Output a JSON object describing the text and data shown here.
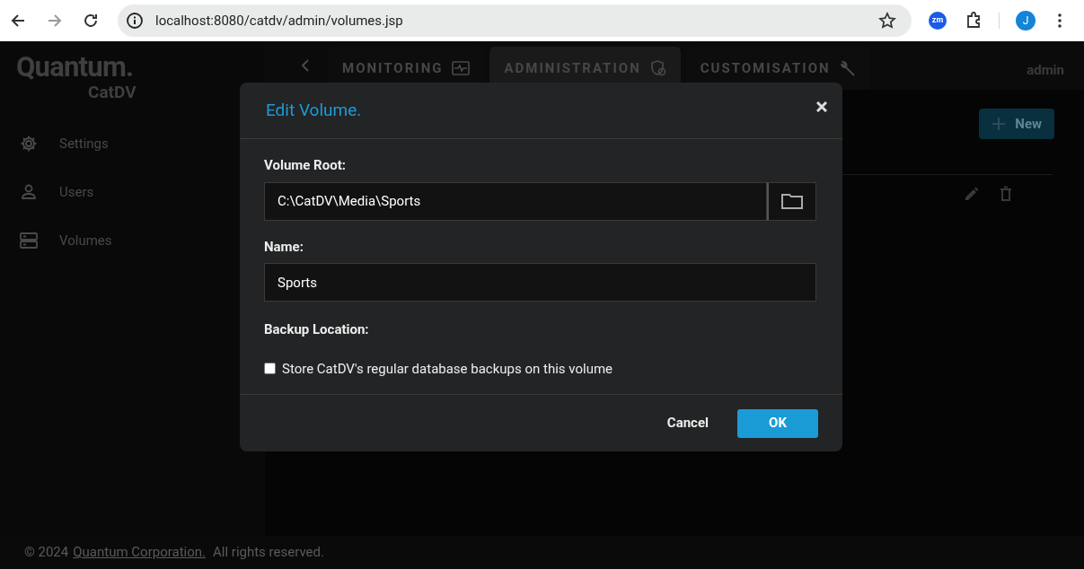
{
  "browser": {
    "url": "localhost:8080/catdv/admin/volumes.jsp",
    "profile_initial": "J",
    "extension_label": "zm"
  },
  "logo": {
    "brand": "Quantum.",
    "product": "CatDV"
  },
  "nav_tabs": [
    {
      "label": "MONITORING",
      "selected": false
    },
    {
      "label": "ADMINISTRATION",
      "selected": true
    },
    {
      "label": "CUSTOMISATION",
      "selected": false
    }
  ],
  "user": "admin",
  "sidebar": {
    "items": [
      {
        "label": "Settings"
      },
      {
        "label": "Users"
      },
      {
        "label": "Volumes"
      }
    ]
  },
  "new_button": {
    "label": "New"
  },
  "dialog": {
    "title": "Edit Volume.",
    "volume_root": {
      "label": "Volume Root:",
      "value": "C:\\CatDV\\Media\\Sports"
    },
    "name": {
      "label": "Name:",
      "value": "Sports"
    },
    "backup": {
      "label": "Backup Location:",
      "checkbox_label": "Store CatDV's regular database backups on this volume",
      "checked": false
    },
    "buttons": [
      {
        "label": "Cancel",
        "kind": "secondary"
      },
      {
        "label": "OK",
        "kind": "primary"
      }
    ]
  },
  "footer": {
    "prefix": "© 2024",
    "link": "Quantum Corporation.",
    "suffix": "All rights reserved."
  }
}
